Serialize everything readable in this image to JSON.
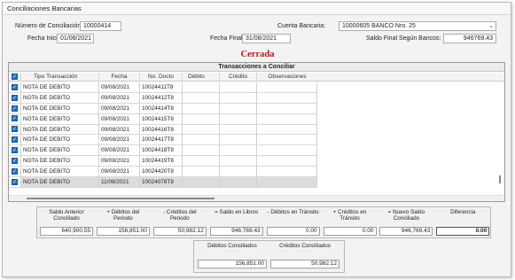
{
  "window": {
    "title": "Conciliaciones Bancarias"
  },
  "form": {
    "conciliacion_label": "Número de Conciliación:",
    "conciliacion_value": "10000414",
    "cuenta_label": "Cuenta Bancaria:",
    "cuenta_value": "10000605  BANCO Nro. 25",
    "fecha_inicial_label": "Fecha Inicial:",
    "fecha_inicial_value": "01/08/2021",
    "fecha_final_label": "Fecha Final:",
    "fecha_final_value": "31/08/2021",
    "saldo_final_label": "Saldo Final Según Bancos:",
    "saldo_final_value": "946769.43"
  },
  "status": {
    "text": "Cerrada",
    "color": "#c01818"
  },
  "grid": {
    "title": "Transacciones a Conciliar",
    "columns": [
      "Tipo Transacción",
      "Fecha",
      "No. Docto",
      "Débito",
      "Crédito",
      "Observaciones"
    ],
    "rows": [
      {
        "checked": true,
        "tipo": "NOTA DE DEBITO",
        "fecha": "09/08/2021",
        "docto": "10024411T8",
        "debito": "",
        "credito": "",
        "obs": ""
      },
      {
        "checked": true,
        "tipo": "NOTA DE DEBITO",
        "fecha": "09/08/2021",
        "docto": "10024412T8",
        "debito": "",
        "credito": "",
        "obs": ""
      },
      {
        "checked": true,
        "tipo": "NOTA DE DEBITO",
        "fecha": "09/08/2021",
        "docto": "10024414T8",
        "debito": "",
        "credito": "",
        "obs": ""
      },
      {
        "checked": true,
        "tipo": "NOTA DE DEBITO",
        "fecha": "09/08/2021",
        "docto": "10024415T8",
        "debito": "",
        "credito": "",
        "obs": ""
      },
      {
        "checked": true,
        "tipo": "NOTA DE DEBITO",
        "fecha": "09/08/2021",
        "docto": "10024416T8",
        "debito": "",
        "credito": "",
        "obs": ""
      },
      {
        "checked": true,
        "tipo": "NOTA DE DEBITO",
        "fecha": "09/08/2021",
        "docto": "10024417T8",
        "debito": "",
        "credito": "",
        "obs": ""
      },
      {
        "checked": true,
        "tipo": "NOTA DE DEBITO",
        "fecha": "09/08/2021",
        "docto": "10024418T8",
        "debito": "",
        "credito": "",
        "obs": ""
      },
      {
        "checked": true,
        "tipo": "NOTA DE DEBITO",
        "fecha": "09/08/2021",
        "docto": "10024419T8",
        "debito": "",
        "credito": "",
        "obs": ""
      },
      {
        "checked": true,
        "tipo": "NOTA DE DEBITO",
        "fecha": "09/08/2021",
        "docto": "10024420T8",
        "debito": "",
        "credito": "",
        "obs": ""
      },
      {
        "checked": true,
        "tipo": "NOTA DE DEBITO",
        "fecha": "11/08/2021",
        "docto": "10024078T8",
        "debito": "",
        "credito": "",
        "obs": "",
        "selected": true
      }
    ]
  },
  "summary": {
    "items": [
      {
        "label": "Saldo Anterior Conciliado",
        "value": "640,900.55"
      },
      {
        "label": "+ Débitos del Periodo",
        "value": "156,851.00"
      },
      {
        "label": "- Créditos del Periodo",
        "value": "50,982.12"
      },
      {
        "label": "= Saldo en Libros",
        "value": "946,769.43"
      },
      {
        "label": "- Débitos en Tránsito",
        "value": "0.00"
      },
      {
        "label": "+ Créditos en Tránsito",
        "value": "0.00"
      },
      {
        "label": "= Nuevo Saldo Conciliado",
        "value": "946,769.43"
      },
      {
        "label": "Diferencia",
        "value": "0.00"
      }
    ],
    "conciliados": [
      {
        "label": "Débitos Conciliados",
        "value": "156,851.00"
      },
      {
        "label": "Créditos Conciliados",
        "value": "50,982.12"
      }
    ]
  }
}
